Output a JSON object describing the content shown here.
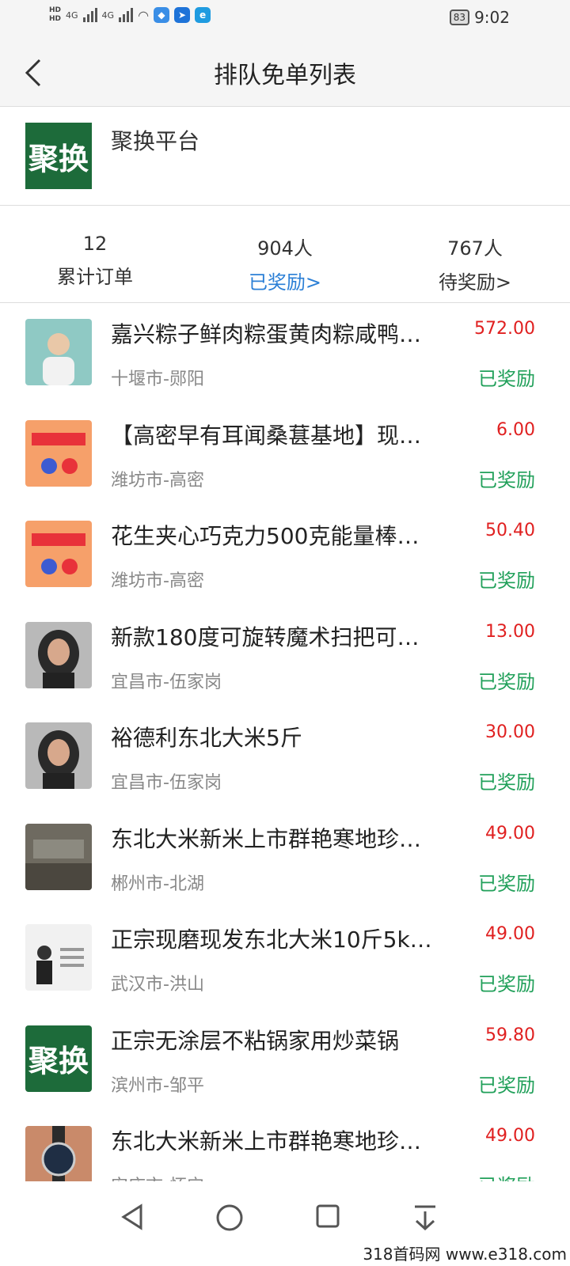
{
  "status_bar": {
    "network_badges": [
      "HD",
      "HD"
    ],
    "signals": [
      "4G",
      "4G"
    ],
    "battery": "83",
    "time": "9:02"
  },
  "nav": {
    "back_icon": "chevron-left-icon",
    "title": "排队免单列表"
  },
  "shop": {
    "logo_text": "聚换",
    "name": "聚换平台"
  },
  "stats": [
    {
      "value": "12",
      "label": "累计订单"
    },
    {
      "value": "904人",
      "label": "已奖励>"
    },
    {
      "value": "767人",
      "label": "待奖励>"
    }
  ],
  "orders": [
    {
      "title": "嘉兴粽子鲜肉粽蛋黄肉粽咸鸭…",
      "location": "十堰市-郧阳",
      "price": "572.00",
      "status": "已奖励",
      "thumb": "photo-man"
    },
    {
      "title": "【高密早有耳闻桑葚基地】现…",
      "location": "潍坊市-高密",
      "price": "6.00",
      "status": "已奖励",
      "thumb": "poster"
    },
    {
      "title": "花生夹心巧克力500克能量棒…",
      "location": "潍坊市-高密",
      "price": "50.40",
      "status": "已奖励",
      "thumb": "poster"
    },
    {
      "title": "新款180度可旋转魔术扫把可…",
      "location": "宜昌市-伍家岗",
      "price": "13.00",
      "status": "已奖励",
      "thumb": "photo-woman"
    },
    {
      "title": "裕德利东北大米5斤",
      "location": "宜昌市-伍家岗",
      "price": "30.00",
      "status": "已奖励",
      "thumb": "photo-woman"
    },
    {
      "title": "东北大米新米上市群艳寒地珍…",
      "location": "郴州市-北湖",
      "price": "49.00",
      "status": "已奖励",
      "thumb": "photo-hall"
    },
    {
      "title": "正宗现磨现发东北大米10斤5k…",
      "location": "武汉市-洪山",
      "price": "49.00",
      "status": "已奖励",
      "thumb": "card"
    },
    {
      "title": "正宗无涂层不粘锅家用炒菜锅",
      "location": "滨州市-邹平",
      "price": "59.80",
      "status": "已奖励",
      "thumb": "logo"
    },
    {
      "title": "东北大米新米上市群艳寒地珍…",
      "location": "安庆市-怀宁",
      "price": "49.00",
      "status": "已奖励",
      "thumb": "photo-watch"
    }
  ],
  "bottom_nav": {
    "icons": [
      "back-triangle-icon",
      "home-circle-icon",
      "recents-square-icon",
      "notification-pull-icon"
    ]
  },
  "watermark": "318首码网 www.e318.com"
}
